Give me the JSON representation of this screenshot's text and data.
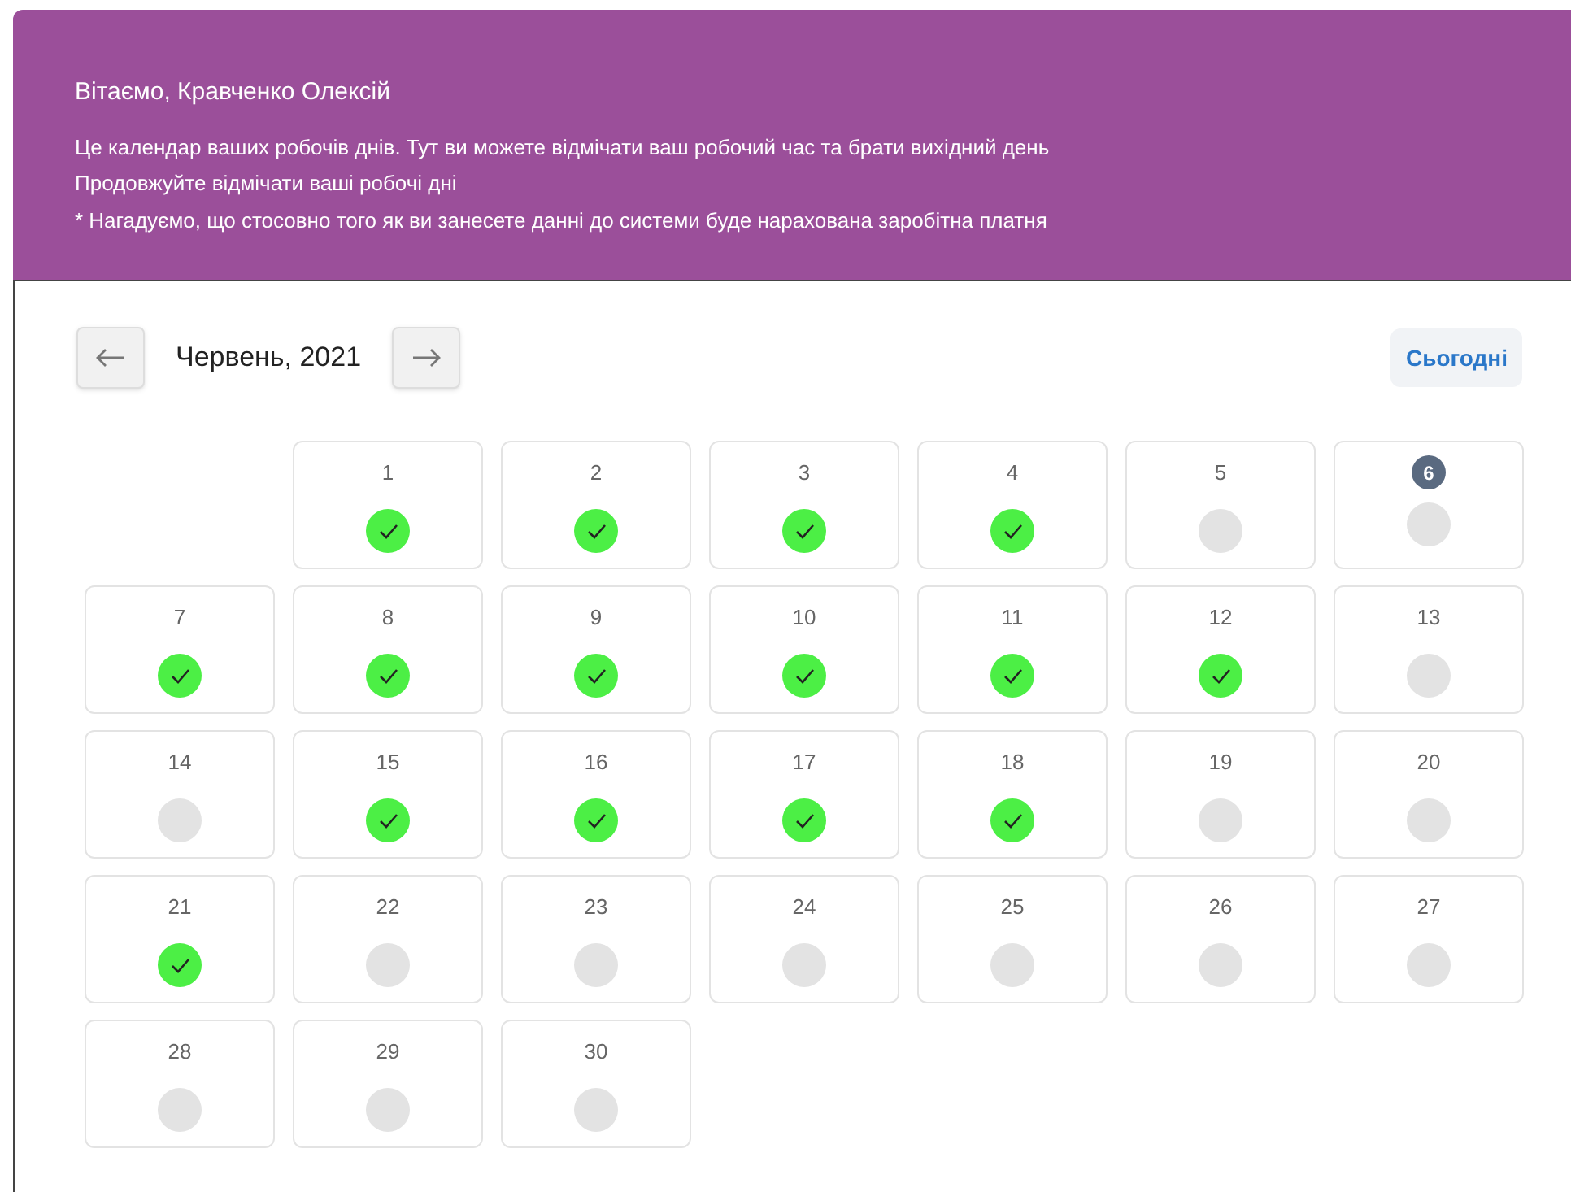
{
  "header": {
    "greeting": "Вітаємо, Кравченко Олексій",
    "lines": [
      "Це календар ваших робочів днів. Тут ви можете відмічати ваш робочий час та брати вихідний день",
      "Продовжуйте відмічати ваші робочі дні",
      "* Нагадуємо, що стосовно того як ви занесете данні до системи буде нарахована заробітна платня"
    ]
  },
  "nav": {
    "month": "Червень, 2021",
    "today_button": "Сьогодні"
  },
  "weeks": [
    {
      "days": [
        {
          "label": "1",
          "worked": true,
          "today": false
        },
        {
          "label": "2",
          "worked": true,
          "today": false
        },
        {
          "label": "3",
          "worked": true,
          "today": false
        },
        {
          "label": "4",
          "worked": true,
          "today": false
        },
        {
          "label": "5",
          "worked": false,
          "today": false
        },
        {
          "label": "6",
          "worked": false,
          "today": true
        }
      ]
    },
    {
      "days": [
        {
          "label": "7",
          "worked": true,
          "today": false
        },
        {
          "label": "8",
          "worked": true,
          "today": false
        },
        {
          "label": "9",
          "worked": true,
          "today": false
        },
        {
          "label": "10",
          "worked": true,
          "today": false
        },
        {
          "label": "11",
          "worked": true,
          "today": false
        },
        {
          "label": "12",
          "worked": true,
          "today": false
        },
        {
          "label": "13",
          "worked": false,
          "today": false
        }
      ]
    },
    {
      "days": [
        {
          "label": "14",
          "worked": false,
          "today": false
        },
        {
          "label": "15",
          "worked": true,
          "today": false
        },
        {
          "label": "16",
          "worked": true,
          "today": false
        },
        {
          "label": "17",
          "worked": true,
          "today": false
        },
        {
          "label": "18",
          "worked": true,
          "today": false
        },
        {
          "label": "19",
          "worked": false,
          "today": false
        },
        {
          "label": "20",
          "worked": false,
          "today": false
        }
      ]
    },
    {
      "days": [
        {
          "label": "21",
          "worked": true,
          "today": false
        },
        {
          "label": "22",
          "worked": false,
          "today": false
        },
        {
          "label": "23",
          "worked": false,
          "today": false
        },
        {
          "label": "24",
          "worked": false,
          "today": false
        },
        {
          "label": "25",
          "worked": false,
          "today": false
        },
        {
          "label": "26",
          "worked": false,
          "today": false
        },
        {
          "label": "27",
          "worked": false,
          "today": false
        }
      ]
    },
    {
      "days": [
        {
          "label": "28",
          "worked": false,
          "today": false
        },
        {
          "label": "29",
          "worked": false,
          "today": false
        },
        {
          "label": "30",
          "worked": false,
          "today": false
        }
      ]
    }
  ]
}
